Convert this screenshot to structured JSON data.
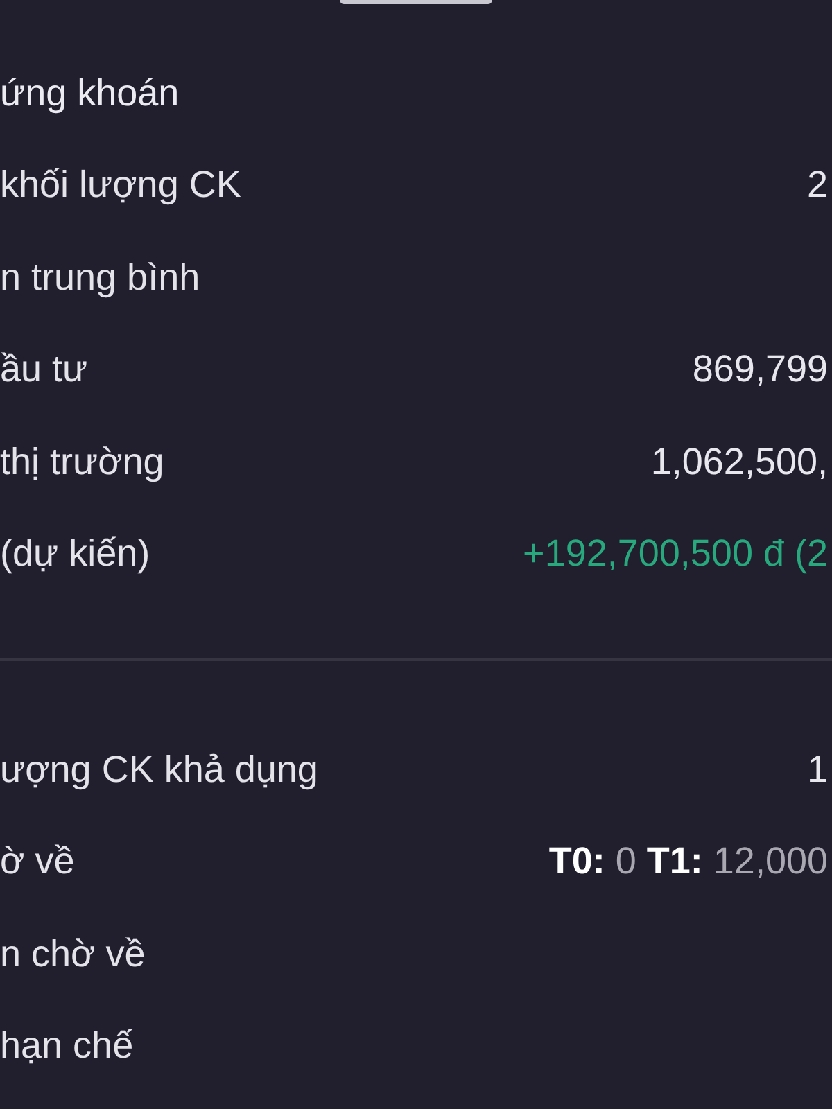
{
  "sections": [
    {
      "title": "ứng khoán",
      "rows": [
        {
          "label": "khối lượng CK",
          "kind": "amount",
          "value": "2"
        },
        {
          "label": "n trung bình"
        },
        {
          "label": "ầu tư",
          "kind": "amount",
          "value": "869,799"
        },
        {
          "label": "thị trường",
          "kind": "amount",
          "value": "1,062,500,"
        },
        {
          "label": "(dự kiến)",
          "kind": "gain",
          "value": "+192,700,500 đ (2"
        }
      ]
    },
    {
      "rows": [
        {
          "label": "ượng CK khả dụng",
          "kind": "amount",
          "value": "1"
        },
        {
          "label": "ờ về",
          "kind": "settlement",
          "value": "**T0:** 0 **T1:** 12,000"
        },
        {
          "label": "n chờ về"
        },
        {
          "label": "hạn chế"
        }
      ]
    }
  ]
}
